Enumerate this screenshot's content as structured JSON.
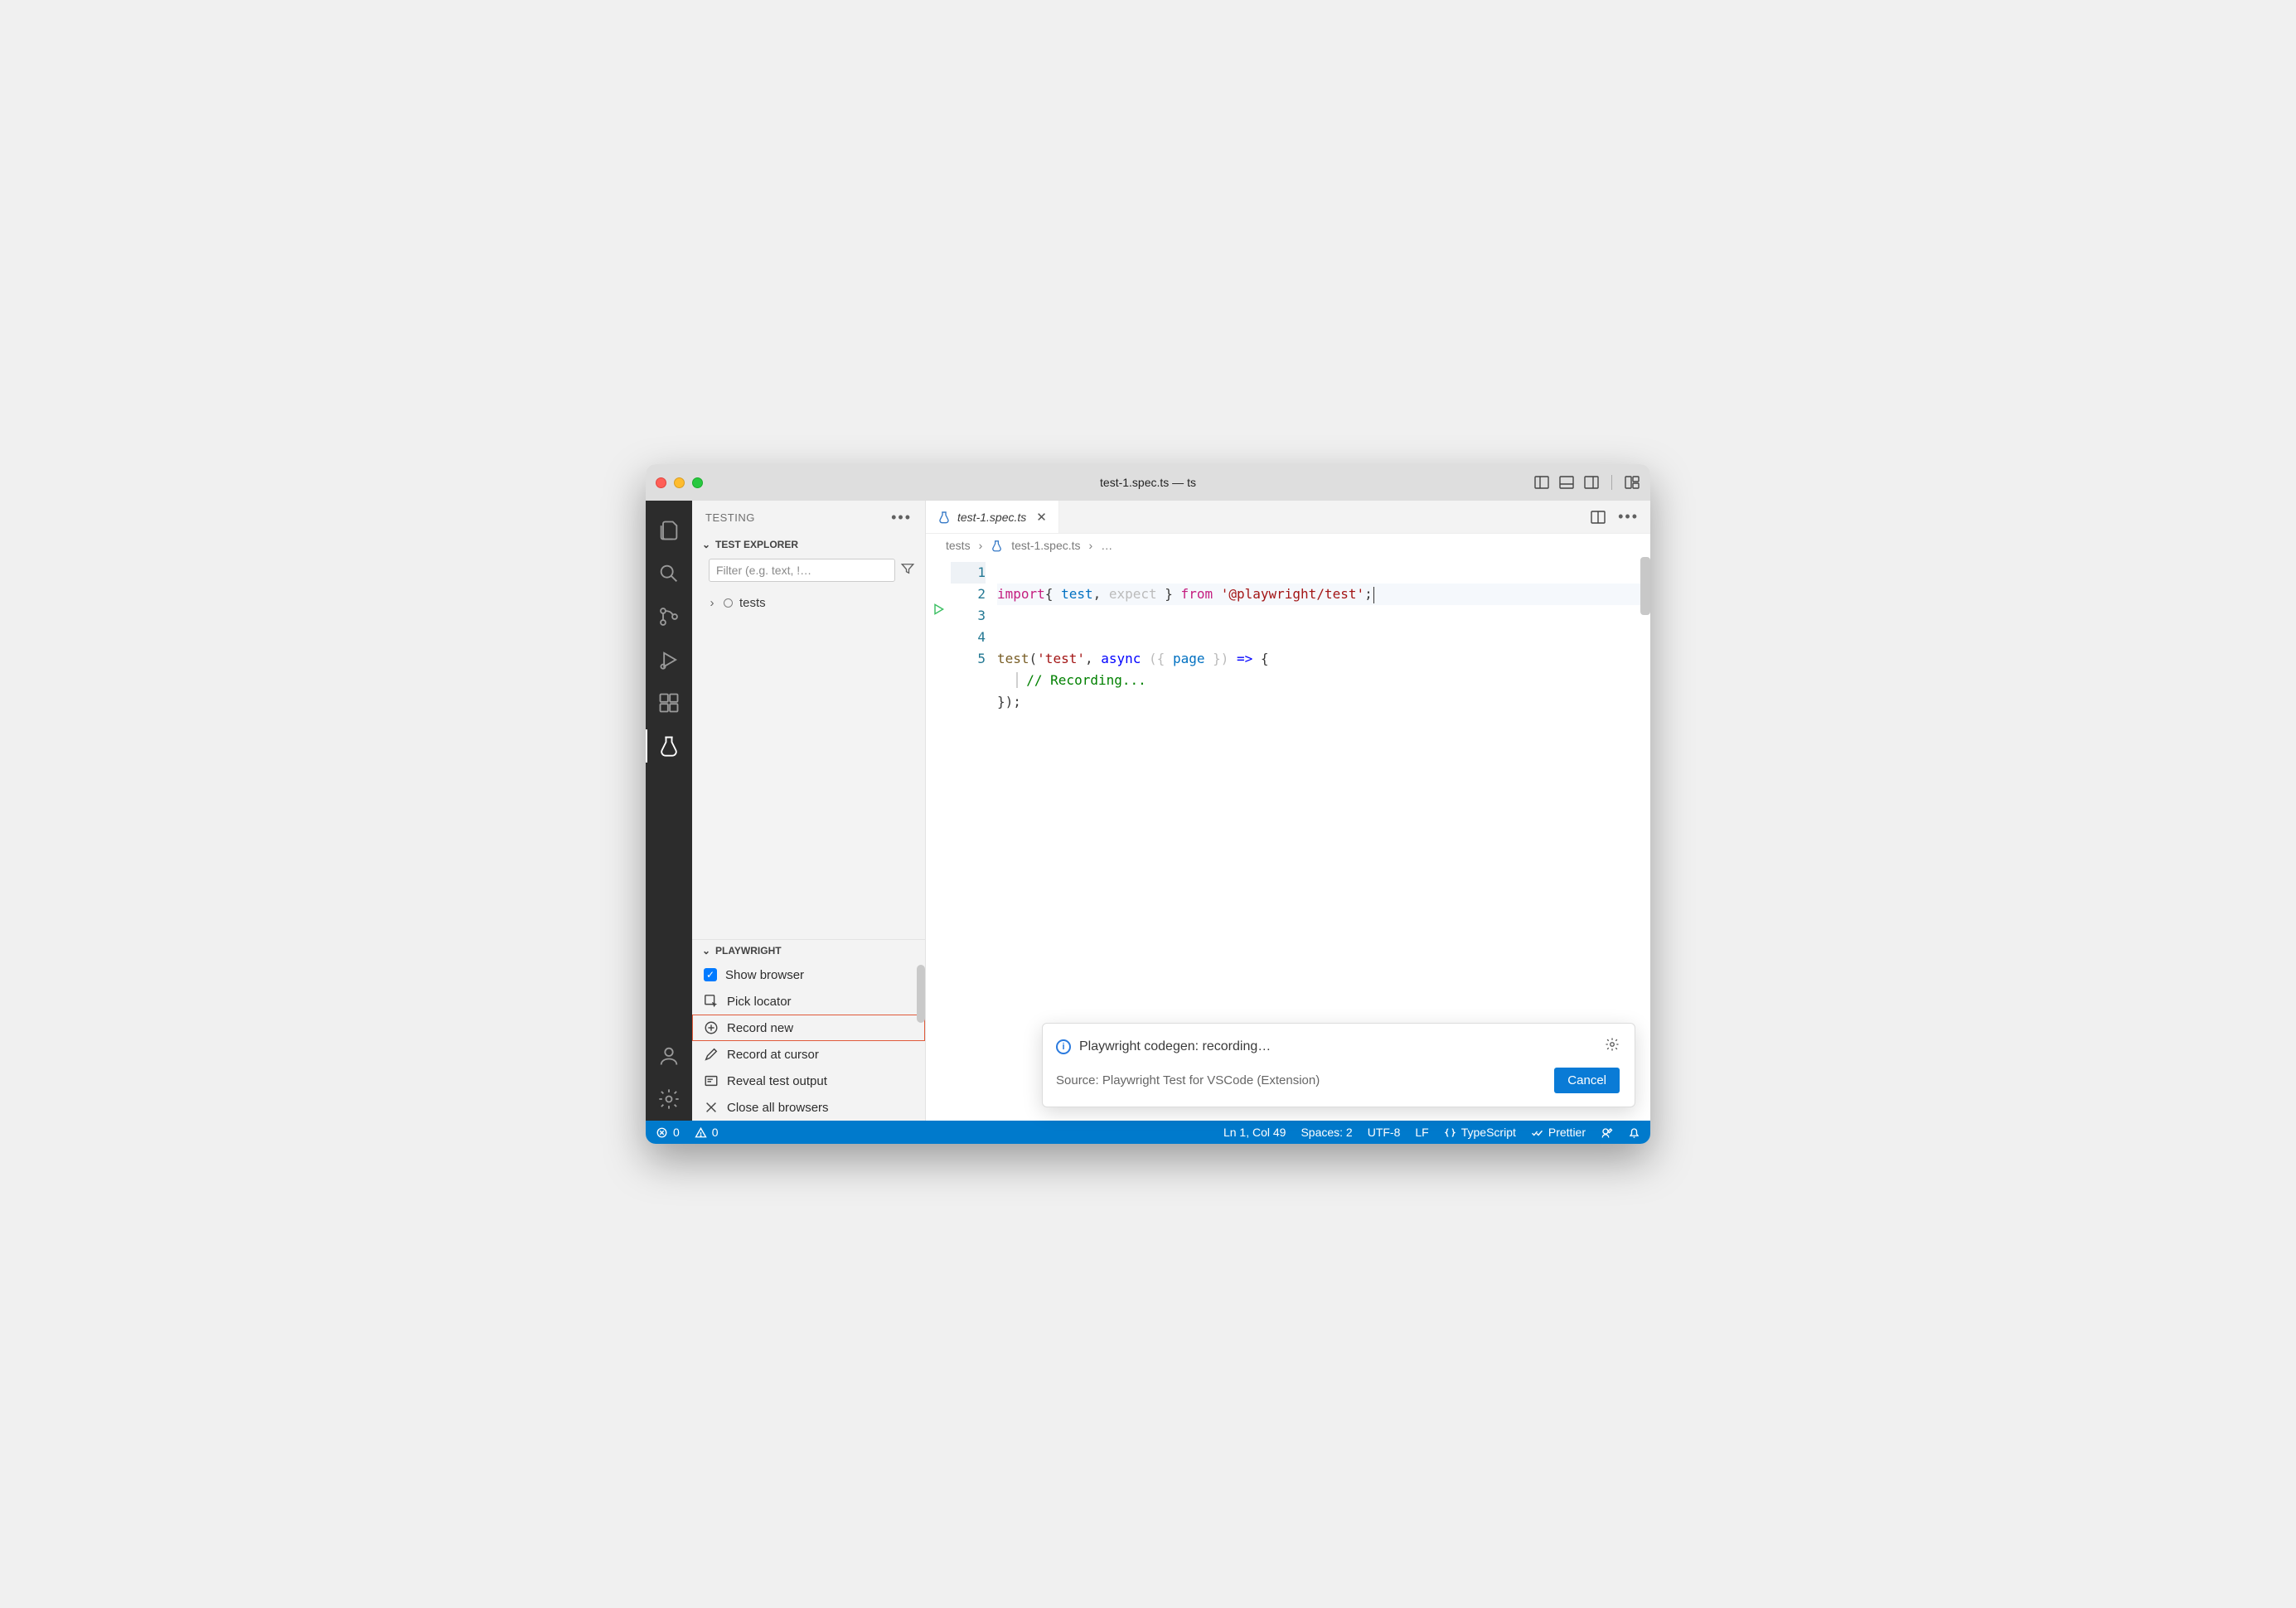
{
  "window": {
    "title": "test-1.spec.ts — ts"
  },
  "sidebar": {
    "header": "TESTING",
    "sections": {
      "explorer_label": "TEST EXPLORER",
      "filter_placeholder": "Filter (e.g. text, !…",
      "tree_root": "tests",
      "playwright_label": "PLAYWRIGHT",
      "playwright_items": [
        {
          "label": "Show browser",
          "icon": "checkbox-checked"
        },
        {
          "label": "Pick locator",
          "icon": "pick"
        },
        {
          "label": "Record new",
          "icon": "plus-circle",
          "highlighted": true
        },
        {
          "label": "Record at cursor",
          "icon": "pencil"
        },
        {
          "label": "Reveal test output",
          "icon": "output"
        },
        {
          "label": "Close all browsers",
          "icon": "close"
        }
      ]
    }
  },
  "editor": {
    "tab": {
      "filename": "test-1.spec.ts"
    },
    "breadcrumbs": {
      "folder": "tests",
      "file": "test-1.spec.ts",
      "trail": "…"
    },
    "lines": [
      "1",
      "2",
      "3",
      "4",
      "5"
    ],
    "code": {
      "l1": {
        "import": "import",
        "lb": "{ ",
        "test": "test",
        "comma": ", ",
        "expect": "expect",
        "rb": " }",
        "from": " from ",
        "pkg": "'@playwright/test'",
        "semi": ";"
      },
      "l3": {
        "fn": "test",
        "lp": "(",
        "name": "'test'",
        "comma": ", ",
        "async": "async",
        "args_l": " ({ ",
        "page": "page",
        "args_r": " }) ",
        "arrow": "=>",
        "brace": " {"
      },
      "l4": {
        "comment": "// Recording..."
      },
      "l5": {
        "close": "});"
      }
    }
  },
  "notification": {
    "title": "Playwright codegen: recording…",
    "source": "Source: Playwright Test for VSCode (Extension)",
    "cancel": "Cancel"
  },
  "statusbar": {
    "errors": "0",
    "warnings": "0",
    "ln_col": "Ln 1, Col 49",
    "spaces": "Spaces: 2",
    "encoding": "UTF-8",
    "eol": "LF",
    "lang": "TypeScript",
    "prettier": "Prettier"
  }
}
